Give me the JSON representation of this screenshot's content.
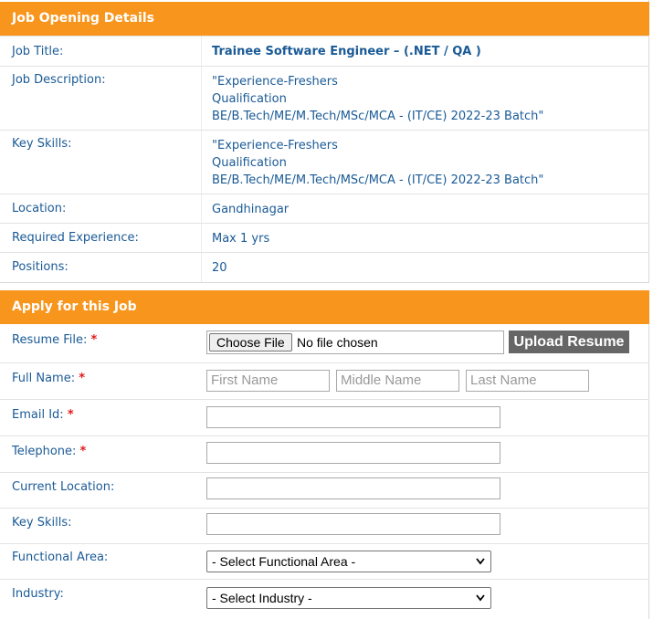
{
  "job_details": {
    "header": "Job Opening Details",
    "rows": [
      {
        "label": "Job Title:",
        "value": "Trainee Software Engineer – (.NET / QA )"
      },
      {
        "label": "Job Description:",
        "lines": [
          "\"Experience-Freshers",
          "Qualification",
          "BE/B.Tech/ME/M.Tech/MSc/MCA - (IT/CE) 2022-23 Batch\""
        ]
      },
      {
        "label": "Key Skills:",
        "lines": [
          "\"Experience-Freshers",
          "Qualification",
          "BE/B.Tech/ME/M.Tech/MSc/MCA - (IT/CE) 2022-23 Batch\""
        ]
      },
      {
        "label": "Location:",
        "value": "Gandhinagar"
      },
      {
        "label": "Required Experience:",
        "value": "Max 1 yrs"
      },
      {
        "label": "Positions:",
        "value": "20"
      }
    ]
  },
  "apply": {
    "header": "Apply for this Job",
    "required_mark": "*",
    "resume": {
      "label": "Resume File:",
      "choose_label": "Choose File",
      "file_status": "No file chosen",
      "upload_label": "Upload Resume"
    },
    "full_name": {
      "label": "Full Name:",
      "first_placeholder": "First Name",
      "middle_placeholder": "Middle Name",
      "last_placeholder": "Last Name"
    },
    "email": {
      "label": "Email Id:",
      "value": ""
    },
    "telephone": {
      "label": "Telephone:",
      "value": ""
    },
    "current_location": {
      "label": "Current Location:",
      "value": ""
    },
    "key_skills": {
      "label": "Key Skills:",
      "value": ""
    },
    "functional_area": {
      "label": "Functional Area:",
      "selected": "- Select Functional Area -"
    },
    "industry": {
      "label": "Industry:",
      "selected": "- Select Industry -"
    }
  },
  "colors": {
    "header_bg": "#f7951d",
    "label_text": "#1a5a96",
    "required": "#e21a1a",
    "upload_bg": "#666666"
  },
  "icons": {
    "select_arrow": "chevron-down-icon"
  }
}
